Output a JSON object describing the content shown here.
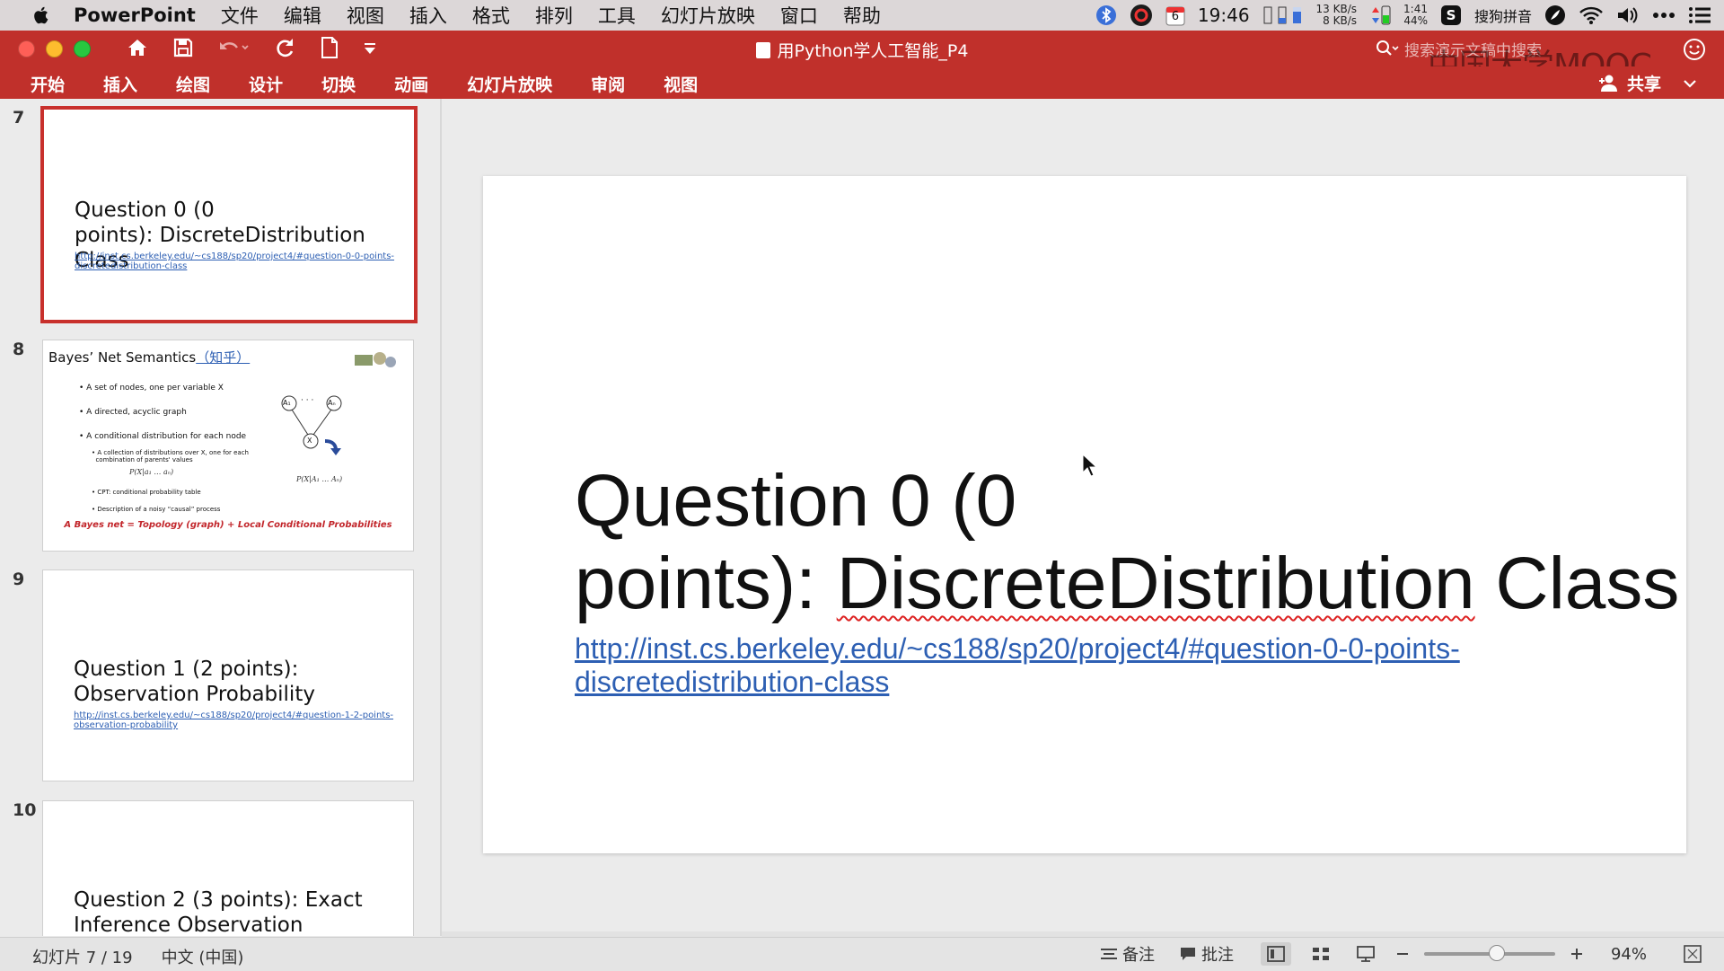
{
  "menubar": {
    "app_name": "PowerPoint",
    "items": [
      "文件",
      "编辑",
      "视图",
      "插入",
      "格式",
      "排列",
      "工具",
      "幻灯片放映",
      "窗口",
      "帮助"
    ],
    "calendar_day": "6",
    "clock": "19:46",
    "net_up": "13 KB/s",
    "net_down": "8 KB/s",
    "battery_time": "1:41",
    "battery_pct": "44%",
    "input_method": "搜狗拼音"
  },
  "window": {
    "title": "用Python学人工智能_P4",
    "search_placeholder": "搜索演示文稿中搜索",
    "watermark": "中国大学MOOC"
  },
  "ribbon": {
    "tabs": [
      "开始",
      "插入",
      "绘图",
      "设计",
      "切换",
      "动画",
      "幻灯片放映",
      "审阅",
      "视图"
    ],
    "share": "共享"
  },
  "thumbnails": [
    {
      "number": "7",
      "title": "Question 0 (0 points): DiscreteDistribution Class",
      "title_l1": "Question 0 (0",
      "title_l2": "points): DiscreteDistribution Class",
      "link_l1": "http://inst.cs.berkeley.edu/~cs188/sp20/project4/#question-0-0-points-",
      "link_l2": "discretedistribution-class",
      "selected": true
    },
    {
      "number": "8",
      "title": "Bayes’ Net Semantics",
      "title_link": "（知乎）",
      "bullets": [
        "A set of nodes, one per variable X",
        "A directed, acyclic graph",
        "A conditional distribution for each node"
      ],
      "sub_bullets": [
        "A collection of distributions over X, one for each",
        "combination of parents' values"
      ],
      "formula_left": "P(X|a₁ … aₙ)",
      "sub_bullets2": [
        "CPT: conditional probability table",
        "Description of a noisy “causal” process"
      ],
      "formula_right": "P(X|A₁ … Aₙ)",
      "node_a1": "A₁",
      "node_an": "Aₙ",
      "node_x": "X",
      "dots": "· · ·",
      "footer": "A Bayes net = Topology (graph) + Local Conditional Probabilities"
    },
    {
      "number": "9",
      "title_l1": "Question 1 (2 points):",
      "title_l2": "Observation Probability",
      "link_l1": "http://inst.cs.berkeley.edu/~cs188/sp20/project4/#question-1-2-points-",
      "link_l2": "observation-probability"
    },
    {
      "number": "10",
      "title_l1": "Question 2 (3 points): Exact",
      "title_l2": "Inference Observation"
    }
  ],
  "slide": {
    "title_l1": "Question 0 (0",
    "title_l2a": "points): ",
    "title_l2b": "DiscreteDistribution",
    "title_l2c": " Class",
    "link_l1": "http://inst.cs.berkeley.edu/~cs188/sp20/project4/#question-0-0-points-",
    "link_l2": "discretedistribution-class"
  },
  "statusbar": {
    "slide_counter": "幻灯片 7 / 19",
    "language": "中文 (中国)",
    "notes": "备注",
    "comments": "批注",
    "zoom": "94%",
    "zoom_level": 0.55
  },
  "colors": {
    "ribbon": "#c0302b",
    "selection": "#c8302c",
    "link": "#2d5fb3"
  }
}
